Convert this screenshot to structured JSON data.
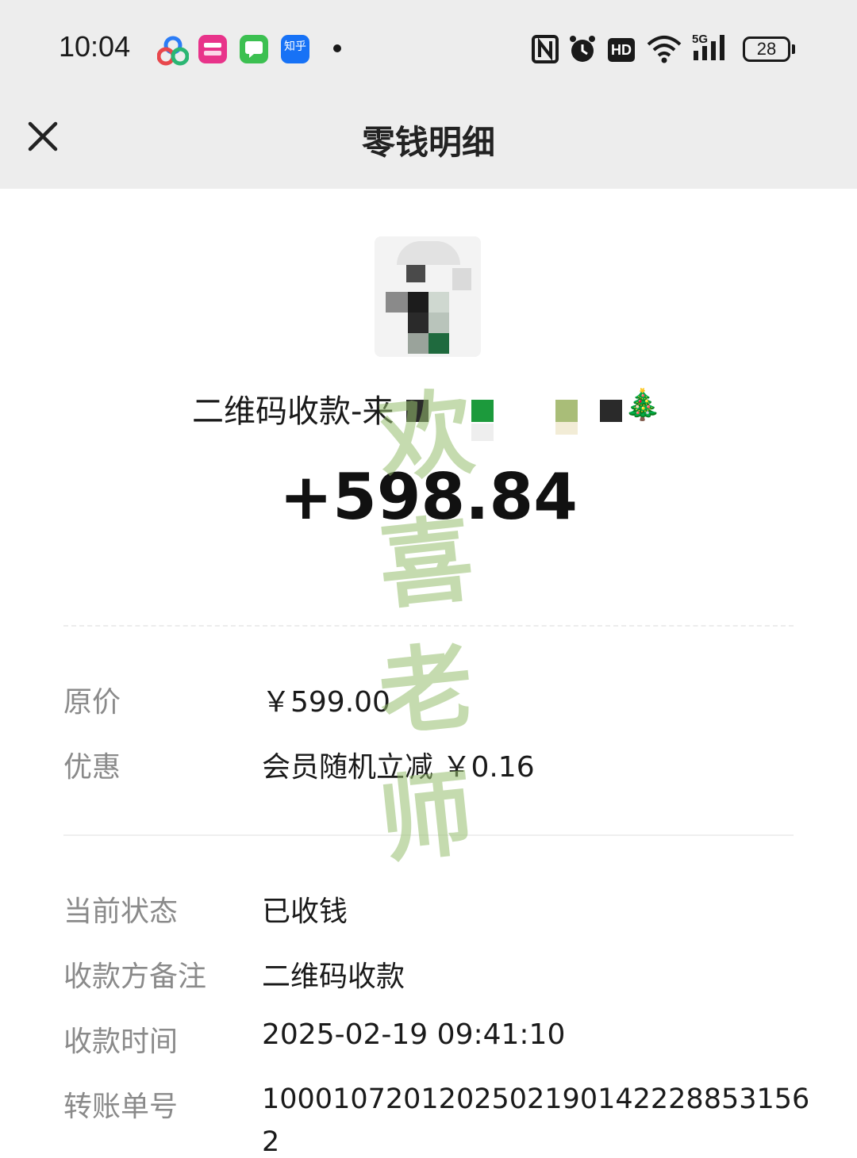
{
  "status_bar": {
    "time": "10:04",
    "battery": "28",
    "icons": [
      "baidu-netdisk-icon",
      "vipshop-icon",
      "messages-icon",
      "zhihu-icon"
    ],
    "right_icons": [
      "nfc-icon",
      "alarm-icon",
      "hd-icon",
      "wifi-icon",
      "5g-signal-icon"
    ],
    "zhihu_label": "知乎"
  },
  "nav": {
    "title": "零钱明细",
    "close_icon": "close-icon"
  },
  "transaction": {
    "merchant": "二维码收款-来",
    "merchant_emoji": "🎄",
    "amount": "+598.84"
  },
  "details": {
    "original_price_label": "原价",
    "original_price_value": "￥599.00",
    "discount_label": "优惠",
    "discount_value": "会员随机立减 ￥0.16",
    "status_label": "当前状态",
    "status_value": "已收钱",
    "remark_label": "收款方备注",
    "remark_value": "二维码收款",
    "time_label": "收款时间",
    "time_value": "2025-02-19 09:41:10",
    "order_label": "转账单号",
    "order_value": "100010720120250219014222885315​6",
    "order_value_line2": "2"
  },
  "watermark": {
    "chars": [
      "欢",
      "喜",
      "老",
      "师"
    ]
  },
  "colors": {
    "header_bg": "#ededed",
    "label": "#8a8a8a",
    "value": "#1a1a1a",
    "watermark": "#96be6e"
  }
}
